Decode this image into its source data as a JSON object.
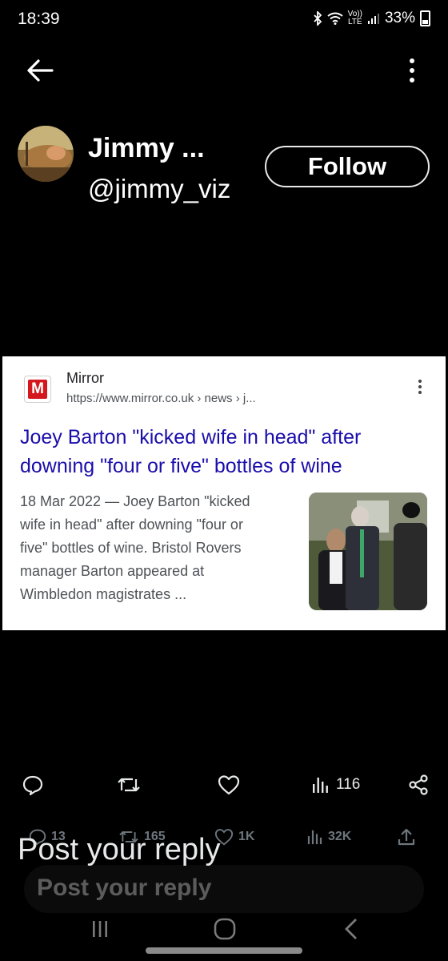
{
  "status": {
    "time": "18:39",
    "battery": "33%",
    "volte_top": "Vo))",
    "volte_bottom": "LTE"
  },
  "profile": {
    "name": "Jimmy ...",
    "handle": "@jimmy_viz",
    "follow_label": "Follow"
  },
  "card": {
    "logo_letter": "M",
    "site_name": "Mirror",
    "url": "https://www.mirror.co.uk › news › j...",
    "headline_1": "Joey Barton \"kicked wife in head\" after",
    "headline_2": "downing \"four or five\" bottles of wine",
    "snippet_1": "18 Mar 2022 — Joey Barton \"kicked",
    "snippet_2": "wife in head\" after downing \"four or",
    "snippet_3": "five\" bottles of wine. Bristol Rovers",
    "snippet_4": "manager Barton appeared at",
    "snippet_5": "Wimbledon magistrates ..."
  },
  "actions": {
    "views": "116"
  },
  "original_stats": {
    "replies": "13",
    "reposts": "165",
    "likes": "1K",
    "views": "32K"
  },
  "reply": {
    "placeholder_large": "Post your reply",
    "placeholder_ghost": "Post your reply"
  },
  "colors": {
    "accent": "#1a0dab",
    "mirror_red": "#d4171d",
    "background": "#000000"
  }
}
